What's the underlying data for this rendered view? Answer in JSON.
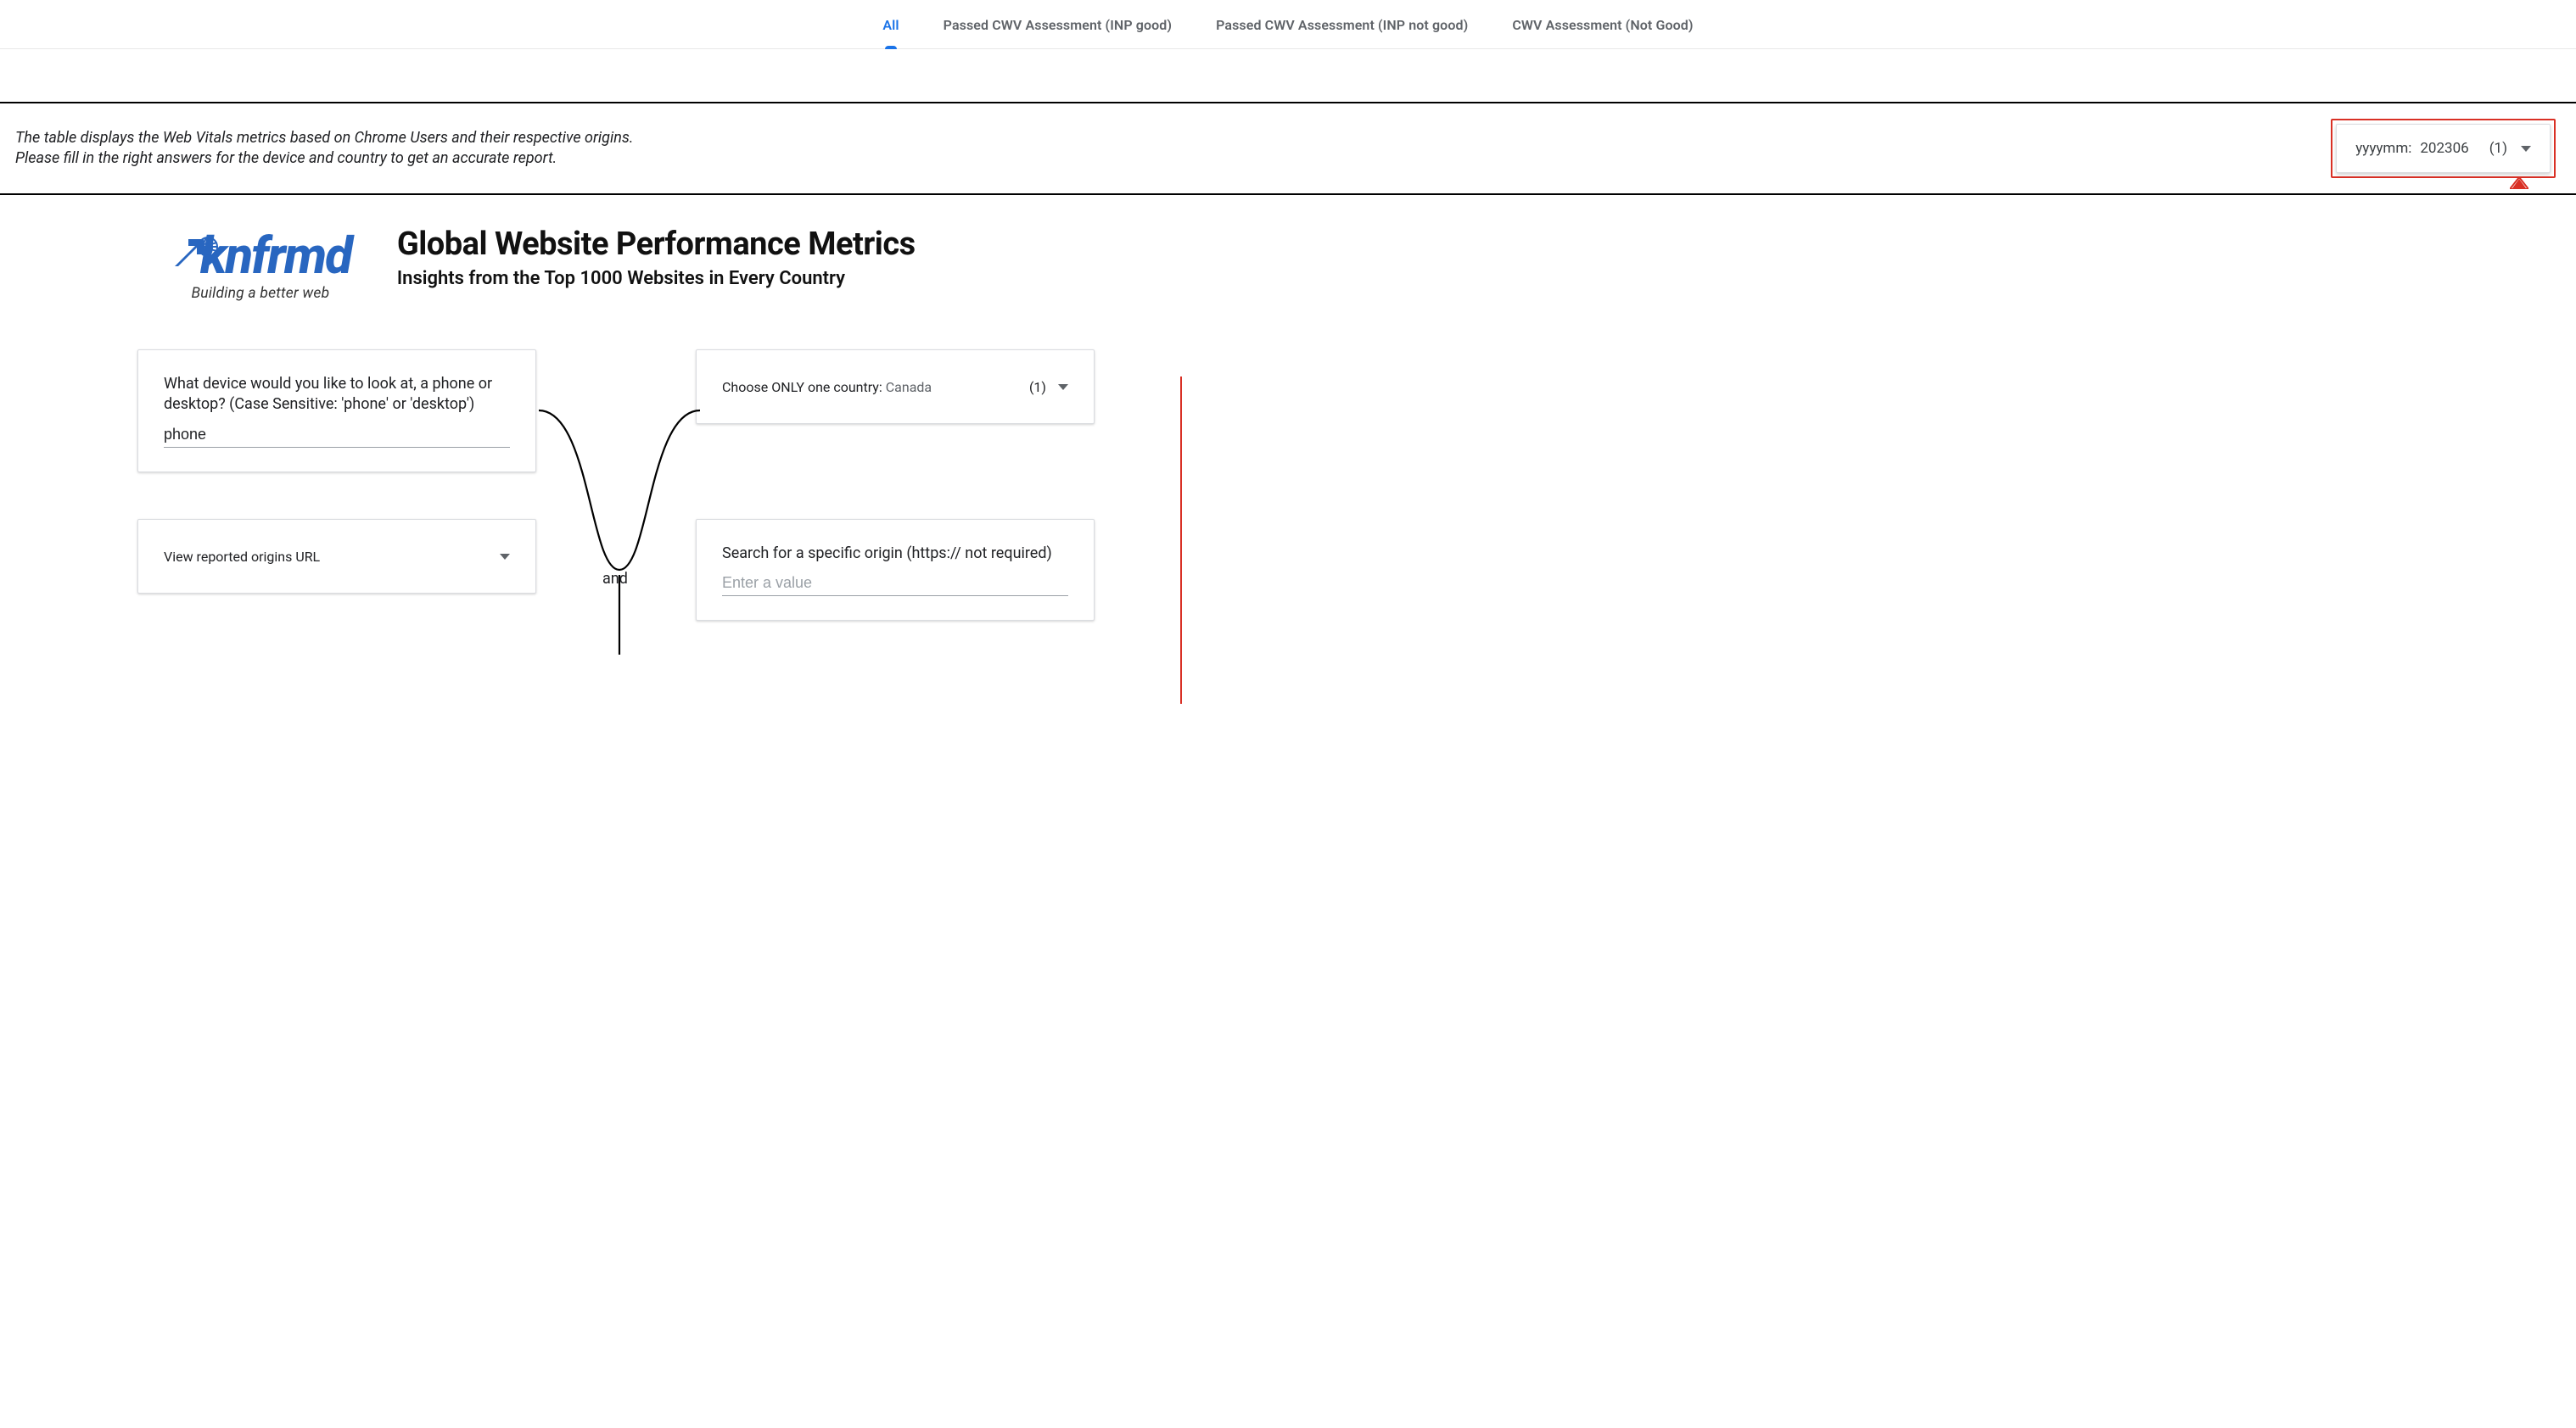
{
  "tabs": {
    "items": [
      {
        "label": "All",
        "active": true
      },
      {
        "label": "Passed CWV Assessment (INP good)",
        "active": false
      },
      {
        "label": "Passed CWV Assessment (INP not good)",
        "active": false
      },
      {
        "label": "CWV Assessment (Not Good)",
        "active": false
      }
    ]
  },
  "intro": {
    "line1": "The table displays the Web Vitals metrics based on Chrome Users and their respective origins.",
    "line2": "Please fill in the right answers for the device and country to get an accurate report."
  },
  "date_filter": {
    "label": "yyyymm",
    "value": "202306",
    "count_display": "(1)"
  },
  "logo": {
    "text": "knfrmd",
    "tagline": "Building a better web"
  },
  "hero": {
    "title": "Global Website Performance Metrics",
    "subtitle": "Insights from the Top 1000 Websites in Every Country"
  },
  "device_card": {
    "label": "What device would you like to look at, a phone or desktop? (Case Sensitive: 'phone' or 'desktop')",
    "value": "phone"
  },
  "country_card": {
    "label": "Choose ONLY one country",
    "value": "Canada",
    "count_display": "(1)"
  },
  "connector": {
    "word": "and"
  },
  "origin_select_card": {
    "label": "View reported origins URL"
  },
  "origin_search_card": {
    "label": "Search for a specific origin (https:// not required)",
    "placeholder": "Enter a value",
    "value": ""
  }
}
